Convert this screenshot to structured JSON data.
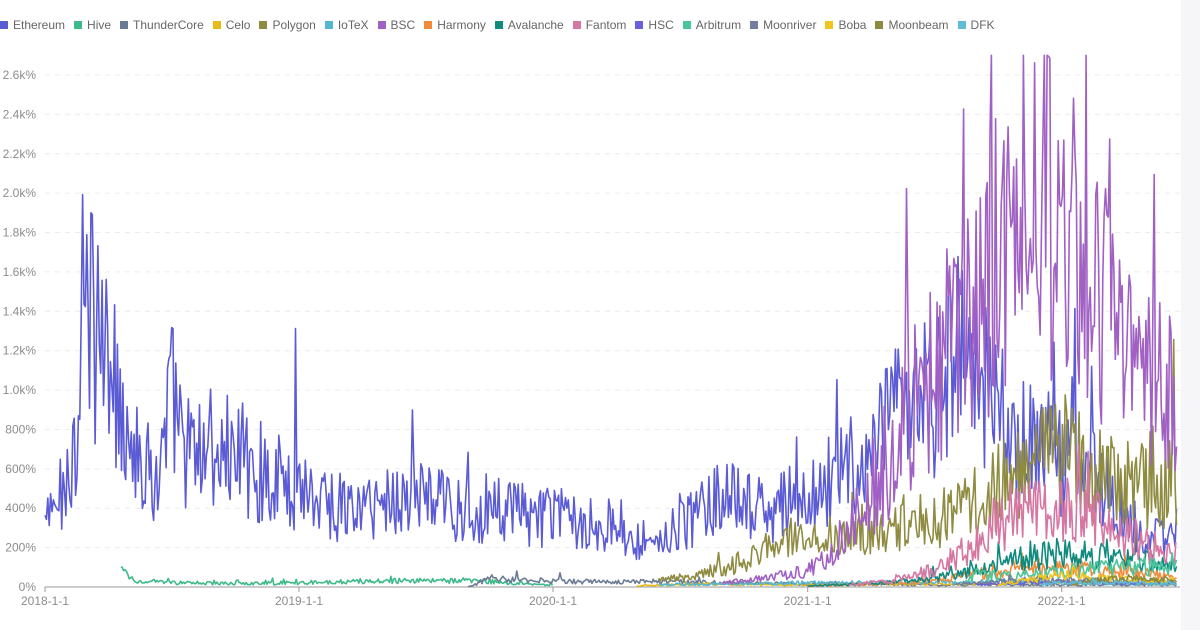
{
  "chart_data": {
    "type": "line",
    "title": "",
    "xlabel": "",
    "ylabel": "",
    "x_ticks": [
      "2018-1-1",
      "2019-1-1",
      "2020-1-1",
      "2021-1-1",
      "2022-1-1"
    ],
    "x_range": [
      "2018-01-01",
      "2022-06-15"
    ],
    "y_ticks": [
      "0%",
      "200%",
      "400%",
      "600%",
      "800%",
      "1.0k%",
      "1.2k%",
      "1.4k%",
      "1.6k%",
      "1.8k%",
      "2.0k%",
      "2.2k%",
      "2.4k%",
      "2.6k%"
    ],
    "ylim": [
      0,
      2600
    ],
    "y_unit": "%",
    "grid": "horizontal dashed",
    "legend_position": "top-left",
    "series": [
      {
        "name": "Ethereum",
        "color": "#5b5bd6",
        "start": "2018-01-01",
        "end": "2022-06-15",
        "points": [
          [
            "2018-01-01",
            300
          ],
          [
            "2018-01-15",
            350
          ],
          [
            "2018-02-01",
            500
          ],
          [
            "2018-02-15",
            700
          ],
          [
            "2018-03-01",
            1300
          ],
          [
            "2018-03-15",
            1200
          ],
          [
            "2018-04-01",
            1000
          ],
          [
            "2018-04-15",
            900
          ],
          [
            "2018-05-01",
            800
          ],
          [
            "2018-05-15",
            600
          ],
          [
            "2018-06-01",
            520
          ],
          [
            "2018-06-15",
            500
          ],
          [
            "2018-07-01",
            900
          ],
          [
            "2018-07-15",
            700
          ],
          [
            "2018-08-01",
            600
          ],
          [
            "2018-09-01",
            650
          ],
          [
            "2018-10-01",
            600
          ],
          [
            "2018-11-01",
            540
          ],
          [
            "2018-12-01",
            500
          ],
          [
            "2019-01-01",
            480
          ],
          [
            "2019-02-01",
            420
          ],
          [
            "2019-03-01",
            370
          ],
          [
            "2019-04-01",
            360
          ],
          [
            "2019-05-01",
            400
          ],
          [
            "2019-06-01",
            420
          ],
          [
            "2019-07-01",
            430
          ],
          [
            "2019-08-01",
            380
          ],
          [
            "2019-09-01",
            360
          ],
          [
            "2019-10-01",
            370
          ],
          [
            "2019-11-01",
            350
          ],
          [
            "2019-12-01",
            330
          ],
          [
            "2020-01-01",
            320
          ],
          [
            "2020-02-01",
            330
          ],
          [
            "2020-03-01",
            300
          ],
          [
            "2020-04-01",
            250
          ],
          [
            "2020-05-01",
            220
          ],
          [
            "2020-06-01",
            230
          ],
          [
            "2020-07-01",
            270
          ],
          [
            "2020-08-01",
            360
          ],
          [
            "2020-09-01",
            420
          ],
          [
            "2020-10-01",
            380
          ],
          [
            "2020-11-01",
            350
          ],
          [
            "2020-12-01",
            380
          ],
          [
            "2021-01-01",
            420
          ],
          [
            "2021-02-01",
            500
          ],
          [
            "2021-03-01",
            550
          ],
          [
            "2021-04-01",
            600
          ],
          [
            "2021-05-01",
            750
          ],
          [
            "2021-06-01",
            820
          ],
          [
            "2021-07-01",
            900
          ],
          [
            "2021-08-01",
            1100
          ],
          [
            "2021-09-01",
            1000
          ],
          [
            "2021-10-01",
            800
          ],
          [
            "2021-11-01",
            700
          ],
          [
            "2021-12-01",
            650
          ],
          [
            "2022-01-01",
            600
          ],
          [
            "2022-02-01",
            550
          ],
          [
            "2022-03-01",
            450
          ],
          [
            "2022-04-01",
            350
          ],
          [
            "2022-05-01",
            250
          ],
          [
            "2022-06-15",
            200
          ]
        ]
      },
      {
        "name": "Hive",
        "color": "#3dba8a",
        "start": "2018-04-20",
        "end": "2020-01-01",
        "points": [
          [
            "2018-04-20",
            80
          ],
          [
            "2018-05-10",
            30
          ],
          [
            "2018-07-01",
            20
          ],
          [
            "2018-10-01",
            15
          ],
          [
            "2019-01-01",
            20
          ],
          [
            "2019-04-01",
            25
          ],
          [
            "2019-07-01",
            30
          ],
          [
            "2019-10-01",
            25
          ],
          [
            "2020-01-01",
            10
          ]
        ]
      },
      {
        "name": "ThunderCore",
        "color": "#6b7b95",
        "start": "2019-09-01",
        "end": "2022-06-15",
        "points": [
          [
            "2019-09-01",
            0
          ],
          [
            "2019-10-01",
            40
          ],
          [
            "2019-12-01",
            30
          ],
          [
            "2020-03-01",
            25
          ],
          [
            "2020-06-01",
            25
          ],
          [
            "2020-09-01",
            20
          ],
          [
            "2020-12-01",
            15
          ],
          [
            "2021-03-01",
            15
          ],
          [
            "2021-06-01",
            10
          ],
          [
            "2021-09-01",
            10
          ],
          [
            "2021-12-01",
            10
          ],
          [
            "2022-03-01",
            10
          ],
          [
            "2022-06-15",
            10
          ]
        ]
      },
      {
        "name": "Celo",
        "color": "#e8bb1a",
        "start": "2020-05-01",
        "end": "2022-06-15",
        "points": [
          [
            "2020-05-01",
            5
          ],
          [
            "2020-08-01",
            15
          ],
          [
            "2020-11-01",
            10
          ],
          [
            "2021-02-01",
            10
          ],
          [
            "2021-05-01",
            15
          ],
          [
            "2021-08-01",
            15
          ],
          [
            "2021-11-01",
            20
          ],
          [
            "2022-02-01",
            20
          ],
          [
            "2022-06-15",
            15
          ]
        ]
      },
      {
        "name": "Polygon",
        "color": "#8f8c42",
        "start": "2020-06-01",
        "end": "2022-06-15",
        "points": [
          [
            "2020-06-01",
            30
          ],
          [
            "2020-08-01",
            60
          ],
          [
            "2020-10-01",
            120
          ],
          [
            "2020-12-01",
            220
          ],
          [
            "2021-01-01",
            230
          ],
          [
            "2021-03-01",
            250
          ],
          [
            "2021-05-01",
            300
          ],
          [
            "2021-07-01",
            320
          ],
          [
            "2021-09-01",
            400
          ],
          [
            "2021-10-01",
            480
          ],
          [
            "2021-11-01",
            560
          ],
          [
            "2021-12-01",
            620
          ],
          [
            "2022-01-01",
            640
          ],
          [
            "2022-02-01",
            560
          ],
          [
            "2022-03-01",
            500
          ],
          [
            "2022-04-01",
            480
          ],
          [
            "2022-05-01",
            460
          ],
          [
            "2022-06-15",
            500
          ]
        ]
      },
      {
        "name": "IoTeX",
        "color": "#55b7cf",
        "start": "2020-06-01",
        "end": "2022-06-15",
        "points": [
          [
            "2020-06-01",
            10
          ],
          [
            "2020-10-01",
            15
          ],
          [
            "2021-01-01",
            20
          ],
          [
            "2021-04-01",
            20
          ],
          [
            "2021-07-01",
            20
          ],
          [
            "2021-10-01",
            25
          ],
          [
            "2022-01-01",
            20
          ],
          [
            "2022-06-15",
            15
          ]
        ]
      },
      {
        "name": "BSC",
        "color": "#a060c4",
        "start": "2020-09-01",
        "end": "2022-06-15",
        "points": [
          [
            "2020-09-01",
            20
          ],
          [
            "2020-11-01",
            40
          ],
          [
            "2021-01-01",
            80
          ],
          [
            "2021-02-01",
            150
          ],
          [
            "2021-03-01",
            280
          ],
          [
            "2021-04-01",
            400
          ],
          [
            "2021-05-01",
            600
          ],
          [
            "2021-06-01",
            850
          ],
          [
            "2021-07-01",
            1000
          ],
          [
            "2021-08-01",
            1150
          ],
          [
            "2021-09-01",
            1300
          ],
          [
            "2021-10-01",
            1550
          ],
          [
            "2021-11-01",
            1700
          ],
          [
            "2021-12-01",
            1800
          ],
          [
            "2022-01-01",
            1700
          ],
          [
            "2022-02-01",
            1500
          ],
          [
            "2022-03-01",
            1300
          ],
          [
            "2022-04-01",
            1150
          ],
          [
            "2022-05-01",
            1000
          ],
          [
            "2022-06-15",
            850
          ]
        ]
      },
      {
        "name": "Harmony",
        "color": "#f08b3c",
        "start": "2021-01-01",
        "end": "2022-06-15",
        "points": [
          [
            "2021-01-01",
            5
          ],
          [
            "2021-04-01",
            10
          ],
          [
            "2021-07-01",
            30
          ],
          [
            "2021-09-01",
            60
          ],
          [
            "2021-11-01",
            90
          ],
          [
            "2022-01-01",
            100
          ],
          [
            "2022-03-01",
            80
          ],
          [
            "2022-06-15",
            50
          ]
        ]
      },
      {
        "name": "Avalanche",
        "color": "#0f8a7e",
        "start": "2021-01-01",
        "end": "2022-06-15",
        "points": [
          [
            "2021-01-01",
            5
          ],
          [
            "2021-04-01",
            15
          ],
          [
            "2021-07-01",
            40
          ],
          [
            "2021-09-01",
            80
          ],
          [
            "2021-11-01",
            130
          ],
          [
            "2022-01-01",
            160
          ],
          [
            "2022-03-01",
            140
          ],
          [
            "2022-06-15",
            100
          ]
        ]
      },
      {
        "name": "Fantom",
        "color": "#d676a2",
        "start": "2021-03-01",
        "end": "2022-06-15",
        "points": [
          [
            "2021-03-01",
            10
          ],
          [
            "2021-05-01",
            30
          ],
          [
            "2021-07-01",
            80
          ],
          [
            "2021-09-01",
            200
          ],
          [
            "2021-10-01",
            280
          ],
          [
            "2021-11-01",
            330
          ],
          [
            "2021-12-01",
            360
          ],
          [
            "2022-01-01",
            370
          ],
          [
            "2022-02-01",
            350
          ],
          [
            "2022-03-01",
            300
          ],
          [
            "2022-04-01",
            260
          ],
          [
            "2022-05-01",
            200
          ],
          [
            "2022-06-15",
            150
          ]
        ]
      },
      {
        "name": "HSC",
        "color": "#6a5fdc",
        "start": "2021-09-01",
        "end": "2022-06-15",
        "points": [
          [
            "2021-09-01",
            10
          ],
          [
            "2021-11-01",
            20
          ],
          [
            "2022-01-01",
            25
          ],
          [
            "2022-03-01",
            20
          ],
          [
            "2022-06-15",
            15
          ]
        ]
      },
      {
        "name": "Arbitrum",
        "color": "#4dc59a",
        "start": "2021-08-15",
        "end": "2022-06-15",
        "points": [
          [
            "2021-08-15",
            20
          ],
          [
            "2021-09-01",
            60
          ],
          [
            "2021-10-01",
            50
          ],
          [
            "2021-12-01",
            60
          ],
          [
            "2022-02-01",
            80
          ],
          [
            "2022-04-01",
            100
          ],
          [
            "2022-06-15",
            90
          ]
        ]
      },
      {
        "name": "Moonriver",
        "color": "#717e9e",
        "start": "2021-08-01",
        "end": "2022-06-15",
        "points": [
          [
            "2021-08-01",
            10
          ],
          [
            "2021-10-01",
            25
          ],
          [
            "2021-12-01",
            35
          ],
          [
            "2022-02-01",
            30
          ],
          [
            "2022-06-15",
            25
          ]
        ]
      },
      {
        "name": "Boba",
        "color": "#f0c51c",
        "start": "2021-10-01",
        "end": "2022-06-15",
        "points": [
          [
            "2021-10-01",
            10
          ],
          [
            "2021-12-01",
            40
          ],
          [
            "2022-01-01",
            60
          ],
          [
            "2022-03-01",
            40
          ],
          [
            "2022-06-15",
            30
          ]
        ]
      },
      {
        "name": "Moonbeam",
        "color": "#8b8a3e",
        "start": "2022-01-15",
        "end": "2022-06-15",
        "points": [
          [
            "2022-01-15",
            10
          ],
          [
            "2022-02-15",
            30
          ],
          [
            "2022-04-01",
            40
          ],
          [
            "2022-06-15",
            35
          ]
        ]
      },
      {
        "name": "DFK",
        "color": "#5fbdd3",
        "start": "2021-12-01",
        "end": "2022-06-15",
        "points": [
          [
            "2021-12-01",
            10
          ],
          [
            "2022-01-01",
            20
          ],
          [
            "2022-03-01",
            20
          ],
          [
            "2022-06-15",
            15
          ]
        ]
      }
    ]
  }
}
